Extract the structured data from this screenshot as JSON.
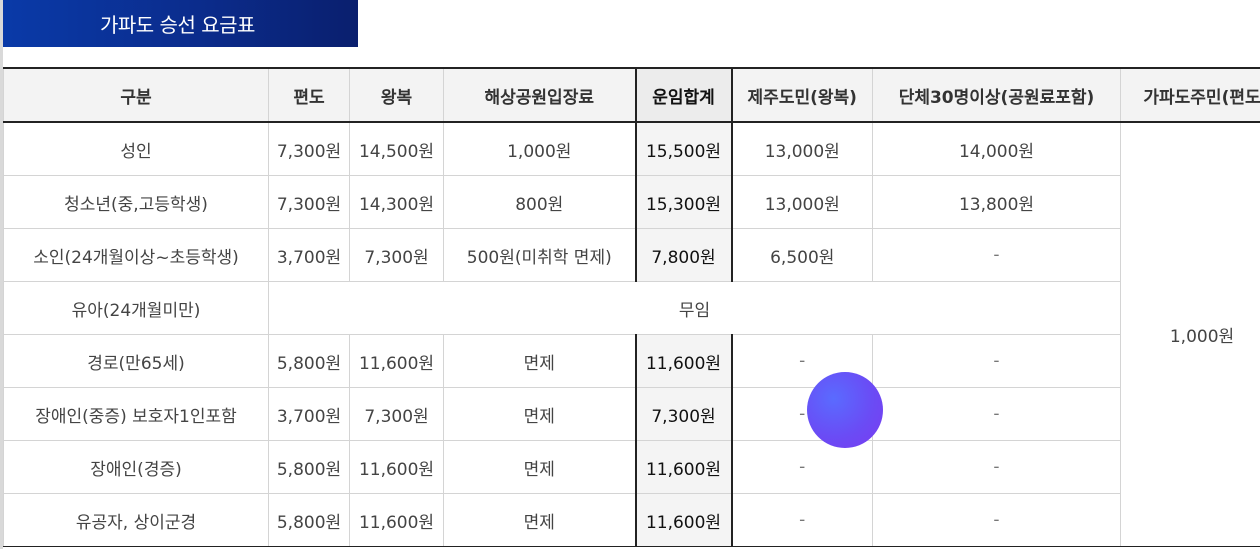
{
  "title": "가파도 승선 요금표",
  "headers": [
    "구분",
    "편도",
    "왕복",
    "해상공원입장료",
    "운임합계",
    "제주도민(왕복)",
    "단체30명이상(공원료포함)",
    "가파도주민(편도"
  ],
  "rows": [
    {
      "category": "성인",
      "oneway": "7,300원",
      "round": "14,500원",
      "park": "1,000원",
      "total": "15,500원",
      "jeju": "13,000원",
      "group": "14,000원"
    },
    {
      "category": "청소년(중,고등학생)",
      "oneway": "7,300원",
      "round": "14,300원",
      "park": "800원",
      "total": "15,300원",
      "jeju": "13,000원",
      "group": "13,800원"
    },
    {
      "category": "소인(24개월이상~초등학생)",
      "oneway": "3,700원",
      "round": "7,300원",
      "park": "500원(미취학 면제)",
      "total": "7,800원",
      "jeju": "6,500원",
      "group": "-"
    },
    {
      "category": "유아(24개월미만)",
      "free": "무임"
    },
    {
      "category": "경로(만65세)",
      "oneway": "5,800원",
      "round": "11,600원",
      "park": "면제",
      "total": "11,600원",
      "jeju": "-",
      "group": "-"
    },
    {
      "category": "장애인(중증) 보호자1인포함",
      "oneway": "3,700원",
      "round": "7,300원",
      "park": "면제",
      "total": "7,300원",
      "jeju": "-",
      "group": "-"
    },
    {
      "category": "장애인(경증)",
      "oneway": "5,800원",
      "round": "11,600원",
      "park": "면제",
      "total": "11,600원",
      "jeju": "-",
      "group": "-"
    },
    {
      "category": "유공자, 상이군경",
      "oneway": "5,800원",
      "round": "11,600원",
      "park": "면제",
      "total": "11,600원",
      "jeju": "-",
      "group": "-"
    }
  ],
  "resident_fare": "1,000원",
  "colors": {
    "title_bg": "#0b2c8c",
    "header_bg": "#f3f3f3",
    "total_bg": "#f4f4f4",
    "circle": "#6a4cf5"
  }
}
